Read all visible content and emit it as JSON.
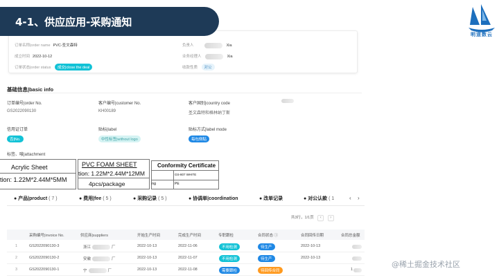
{
  "banner": {
    "title": "4-1、供应应用-采购通知"
  },
  "logo": {
    "text": "明道数云"
  },
  "order_card": {
    "order_name_label": "订单名称|order name",
    "order_name_value": "PVC-圣文森特",
    "owner_label": "负责人",
    "owner_value": "Xia",
    "created_label": "成立时间",
    "created_value": "2022-10-12",
    "salesman_label": "业务经理人",
    "salesman_value": "Xia",
    "status_label": "订单状态|order status",
    "status_value": "成交|close the deal",
    "collect_label": "收款性质",
    "collect_value": "对公"
  },
  "basic_info": {
    "title": "基础信息|basic info",
    "order_no_label": "订单编号|order No.",
    "order_no_value": "GS2022090130",
    "customer_no_label": "客户编号|customer No.",
    "customer_no_value": "KH00189",
    "country_label": "客户国别|country code",
    "country_value": "圣文森特和格林纳丁斯",
    "credit_label": "信用证订单",
    "credit_value": "否|No.",
    "label_label": "贴标|label",
    "label_value": "中性标签|without logo",
    "label_mode_label": "贴标方式|label mode",
    "label_mode_value": "每包侧贴",
    "attachment_label": "标签、唛|attachment"
  },
  "attachment_doc": {
    "acrylic": "Acrylic Sheet",
    "size1": "tion: 1.22M*2.44M*5MM",
    "pvc": "PVC  FOAM SHEET",
    "size2": "tion: 1.22M*2.44M*12MM",
    "pkg": "4pcs/package",
    "cert": "Conformity Certificate",
    "code": "GS-807 WHITE",
    "g": "ng",
    "pe": "PE"
  },
  "tabs": [
    {
      "icon": "●",
      "label": "产品|product",
      "count": "( 7 )"
    },
    {
      "icon": "●",
      "label": "费用|fee",
      "count": "( 5 )"
    },
    {
      "icon": "●",
      "label": "采购记录",
      "count": "( 5 )"
    },
    {
      "icon": "●",
      "label": "协调单|coordination",
      "count": ""
    },
    {
      "icon": "●",
      "label": "改单记录",
      "count": ""
    },
    {
      "icon": "●",
      "label": "对公认款",
      "count": "( 1"
    }
  ],
  "pager": {
    "text": "共3行，1/1页",
    "prev": "‹",
    "next": "›"
  },
  "table": {
    "headers": [
      "采购编号|invoice No.",
      "供应商|suppliers",
      "开始生产时间",
      "完成生产时间",
      "专职跟检",
      "合同状态 ⓘ",
      "合同回传日期",
      "合同总金额"
    ],
    "rows": [
      {
        "idx": "1",
        "invoice": "GS2022090130-3",
        "supplier_a": "浙江",
        "supplier_b": "厂",
        "start": "2022-10-13",
        "end": "2022-11-06",
        "check": "不用检测",
        "status": "待生产",
        "return_date": "2022-10-13",
        "amount": ""
      },
      {
        "idx": "2",
        "invoice": "GS2022090130-2",
        "supplier_a": "安徽",
        "supplier_b": "厂",
        "start": "2022-10-13",
        "end": "2022-11-07",
        "check": "不用检测",
        "status": "待生产",
        "return_date": "2022-10-13",
        "amount": ""
      },
      {
        "idx": "3",
        "invoice": "GS2022090130-1",
        "supplier_a": "宁",
        "supplier_b": "厂",
        "start": "2022-10-13",
        "end": "2022-11-08",
        "check": "需要跟检",
        "status": "待回传合同",
        "return_date": "",
        "amount": "1"
      }
    ]
  },
  "watermark": "@稀土掘金技术社区"
}
